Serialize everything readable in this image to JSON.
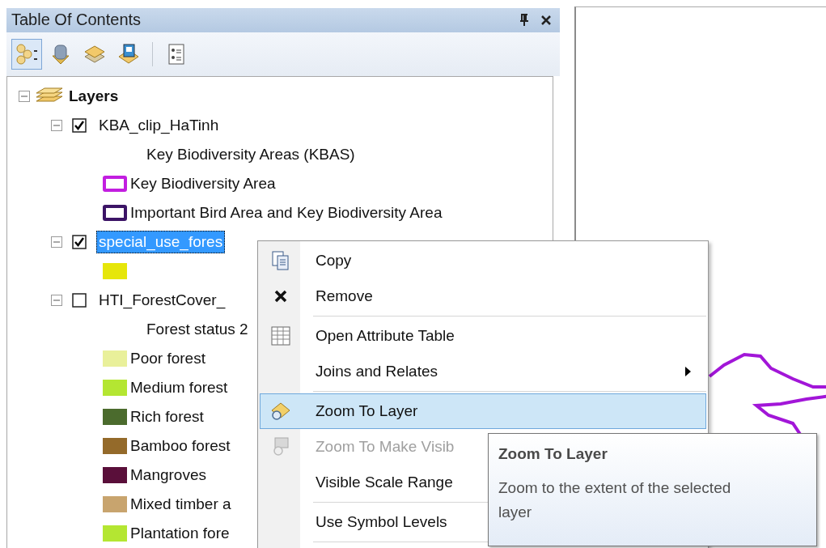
{
  "panel": {
    "title": "Table Of Contents"
  },
  "toolbar": [
    {
      "kind": "drawing_order",
      "selected": true
    },
    {
      "kind": "source",
      "selected": false
    },
    {
      "kind": "visibility",
      "selected": false
    },
    {
      "kind": "selection",
      "selected": false
    },
    {
      "kind": "separator"
    },
    {
      "kind": "options",
      "selected": false
    }
  ],
  "tree": {
    "label": "Layers",
    "expanded": true,
    "children": [
      {
        "label": "KBA_clip_HaTinh",
        "checked": true,
        "expanded": true,
        "selected": false,
        "legend": [
          {
            "kind": "heading",
            "label": "Key Biodiversity Areas (KBAS)"
          },
          {
            "kind": "outline",
            "color": "#c21ee0",
            "label": "Key Biodiversity Area"
          },
          {
            "kind": "outline",
            "color": "#3c1466",
            "label": "Important Bird Area and Key Biodiversity Area"
          }
        ]
      },
      {
        "label": "special_use_fores",
        "checked": true,
        "expanded": true,
        "selected": true,
        "legend": [
          {
            "kind": "fill",
            "color": "#e6e60a"
          }
        ]
      },
      {
        "label": "HTI_ForestCover_",
        "checked": false,
        "expanded": true,
        "selected": false,
        "legend": [
          {
            "kind": "heading",
            "label": "Forest status 2"
          },
          {
            "kind": "fill",
            "color": "#e9f09a",
            "label": "Poor forest"
          },
          {
            "kind": "fill",
            "color": "#b4e632",
            "label": "Medium forest"
          },
          {
            "kind": "fill",
            "color": "#4b6b2d",
            "label": "Rich forest"
          },
          {
            "kind": "fill",
            "color": "#946a2a",
            "label": "Bamboo forest"
          },
          {
            "kind": "fill",
            "color": "#5a0f3a",
            "label": "Mangroves"
          },
          {
            "kind": "fill",
            "color": "#c8a46e",
            "label": "Mixed timber a"
          },
          {
            "kind": "fill",
            "color": "#b4e632",
            "label": "Plantation fore"
          }
        ]
      }
    ]
  },
  "context_menu": [
    {
      "kind": "item",
      "label": "Copy",
      "selected": false,
      "disabled": false,
      "submenu": false
    },
    {
      "kind": "item",
      "label": "Remove",
      "selected": false,
      "disabled": false,
      "submenu": false
    },
    {
      "kind": "separator"
    },
    {
      "kind": "item",
      "label": "Open Attribute Table",
      "selected": false,
      "disabled": false,
      "submenu": false
    },
    {
      "kind": "item",
      "label": "Joins and Relates",
      "selected": false,
      "disabled": false,
      "submenu": true
    },
    {
      "kind": "separator"
    },
    {
      "kind": "item",
      "label": "Zoom To Layer",
      "selected": true,
      "disabled": false
    },
    {
      "kind": "item",
      "label": "Zoom To Make Visib",
      "selected": false,
      "disabled": true
    },
    {
      "kind": "item",
      "label": "Visible Scale Range",
      "selected": false,
      "disabled": false
    },
    {
      "kind": "separator"
    },
    {
      "kind": "item",
      "label": "Use Symbol Levels",
      "selected": false,
      "disabled": false
    },
    {
      "kind": "separator"
    }
  ],
  "tooltip": {
    "title": "Zoom To Layer",
    "text": "Zoom to the extent of the selected layer"
  }
}
